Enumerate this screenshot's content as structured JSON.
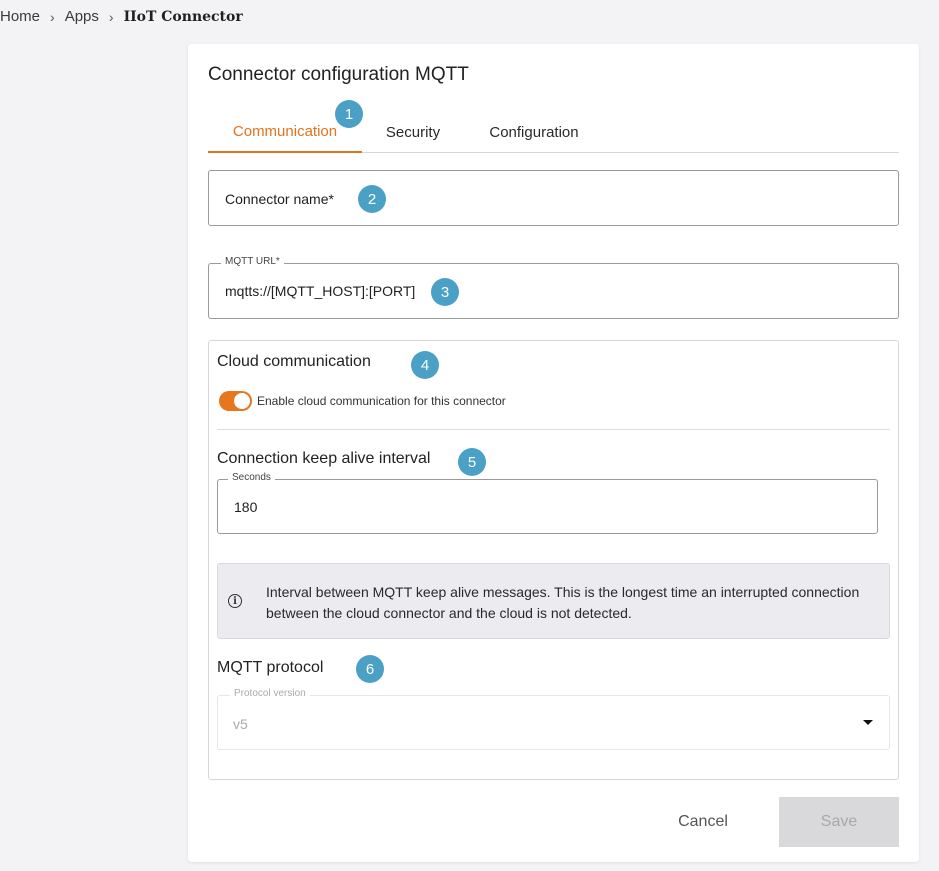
{
  "breadcrumb": {
    "home": "Home",
    "apps": "Apps",
    "current": "IIoT Connector",
    "separator": "›"
  },
  "card": {
    "title": "Connector configuration MQTT"
  },
  "tabs": [
    {
      "label": "Communication",
      "active": true
    },
    {
      "label": "Security",
      "active": false
    },
    {
      "label": "Configuration",
      "active": false
    }
  ],
  "badges": [
    "1",
    "2",
    "3",
    "4",
    "5",
    "6"
  ],
  "connector_name": {
    "label": "Connector name*",
    "value": ""
  },
  "mqtt_url": {
    "label": "MQTT URL*",
    "value": "mqtts://[MQTT_HOST]:[PORT]"
  },
  "cloud": {
    "title": "Cloud communication",
    "toggle_label": "Enable cloud communication for this connector",
    "enabled": true
  },
  "keepalive": {
    "title": "Connection keep alive interval",
    "field_label": "Seconds",
    "value": "180",
    "info_icon": "info-icon",
    "info": "Interval between MQTT keep alive messages. This is the longest time an interrupted connection between the cloud connector and the cloud is not detected."
  },
  "protocol": {
    "title": "MQTT protocol",
    "field_label": "Protocol version",
    "value": "v5"
  },
  "actions": {
    "cancel": "Cancel",
    "save": "Save"
  },
  "colors": {
    "accent": "#e0741e",
    "badge": "#4ba1c5",
    "disabled": "#d9d9dc"
  }
}
